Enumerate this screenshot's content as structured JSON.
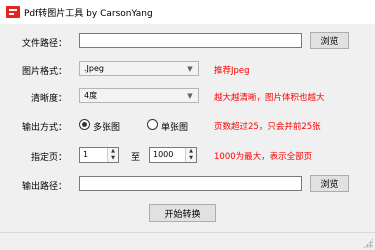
{
  "window": {
    "title": "Pdf转图片工具 by CarsonYang",
    "icon": "pdf-app-icon"
  },
  "form": {
    "file_path": {
      "label": "文件路径：",
      "value": "",
      "browse_label": "浏览"
    },
    "image_format": {
      "label": "图片格式：",
      "selected": ".Jpeg",
      "hint": "推荐Jpeg"
    },
    "clarity": {
      "label": "清晰度：",
      "selected": "4度",
      "hint": "越大越清晰，图片体积也越大"
    },
    "output_mode": {
      "label": "输出方式：",
      "options": [
        {
          "label": "多张图",
          "checked": true
        },
        {
          "label": "单张图",
          "checked": false
        }
      ],
      "hint": "页数超过25，只会并前25张"
    },
    "page_range": {
      "label": "指定页：",
      "from": "1",
      "separator": "至",
      "to": "1000",
      "hint": "1000为最大，表示全部页"
    },
    "output_path": {
      "label": "输出路径：",
      "value": "",
      "browse_label": "浏览"
    },
    "start_label": "开始转换"
  },
  "colors": {
    "hint": "#ff0000",
    "app_icon": "#e8221d"
  }
}
